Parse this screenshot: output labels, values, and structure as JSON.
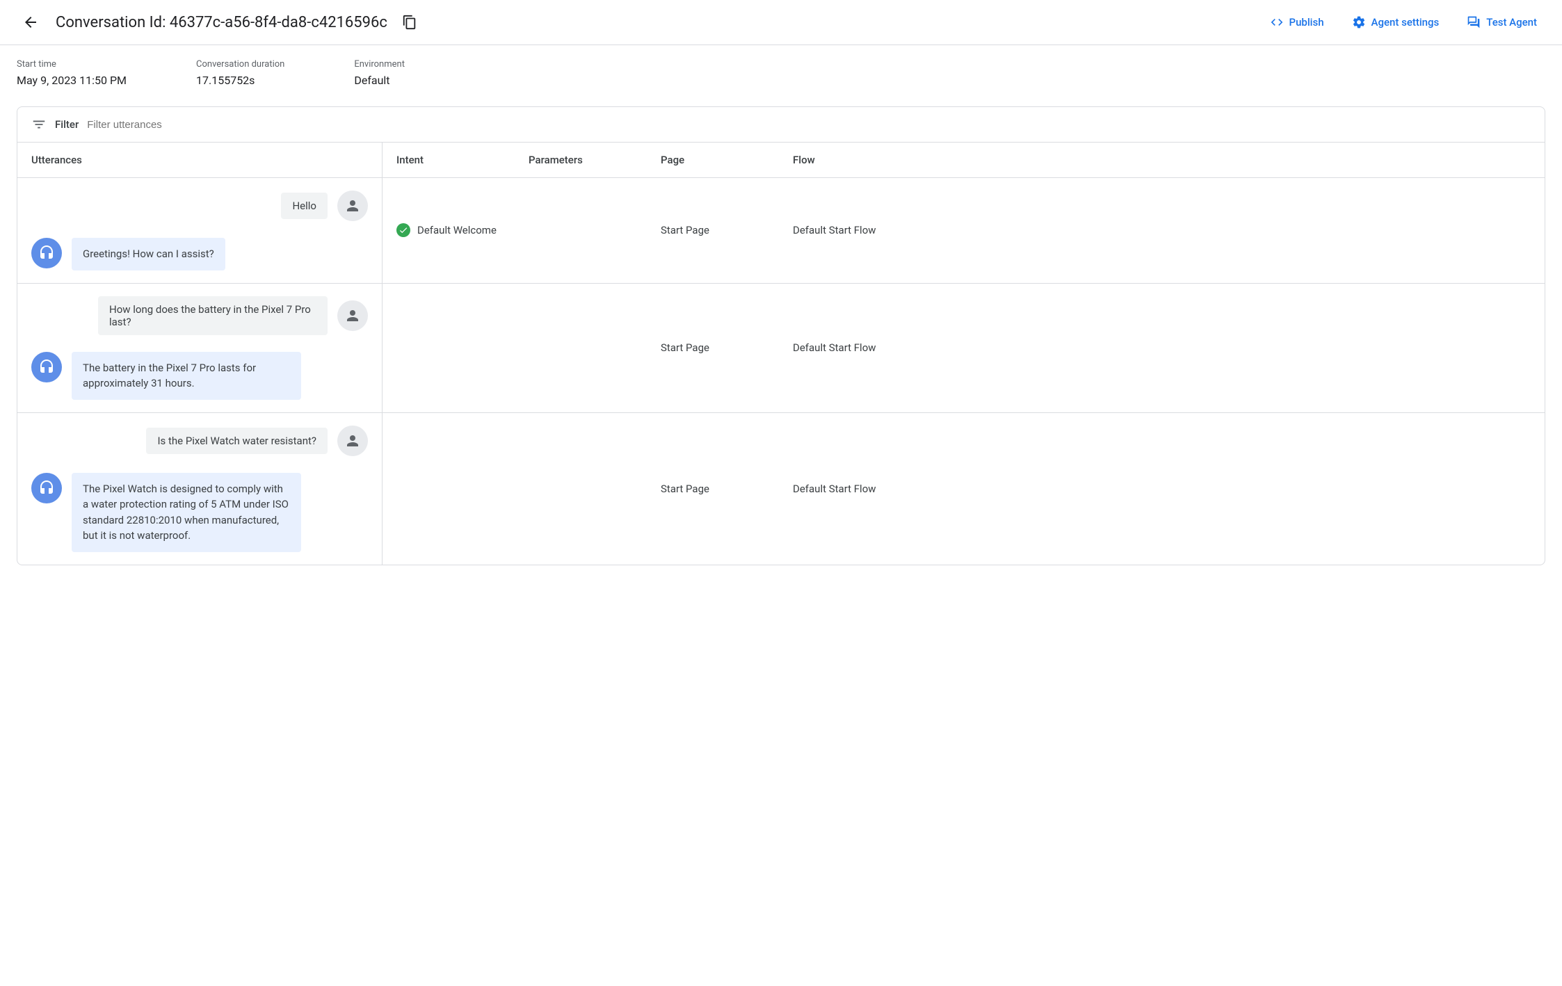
{
  "header": {
    "title": "Conversation Id: 46377c-a56-8f4-da8-c4216596c",
    "actions": {
      "publish": "Publish",
      "agent_settings": "Agent settings",
      "test_agent": "Test Agent"
    }
  },
  "meta": {
    "start_time_label": "Start time",
    "start_time_value": "May 9, 2023 11:50 PM",
    "duration_label": "Conversation duration",
    "duration_value": "17.155752s",
    "environment_label": "Environment",
    "environment_value": "Default"
  },
  "filter": {
    "label": "Filter",
    "placeholder": "Filter utterances"
  },
  "columns": {
    "utterances": "Utterances",
    "intent": "Intent",
    "parameters": "Parameters",
    "page": "Page",
    "flow": "Flow"
  },
  "rows": [
    {
      "user": "Hello",
      "bot": "Greetings! How can I assist?",
      "intent": "Default Welcome",
      "page": "Start Page",
      "flow": "Default Start Flow"
    },
    {
      "user": "How long does the battery in the Pixel 7 Pro last?",
      "bot": "The battery in the Pixel 7 Pro lasts for approximately 31 hours.",
      "intent": "",
      "page": "Start Page",
      "flow": "Default Start Flow"
    },
    {
      "user": "Is the Pixel Watch water resistant?",
      "bot": "The Pixel Watch is designed to comply with a water protection rating of 5 ATM under ISO standard 22810:2010 when manufactured, but it is not waterproof.",
      "intent": "",
      "page": "Start Page",
      "flow": "Default Start Flow"
    }
  ]
}
